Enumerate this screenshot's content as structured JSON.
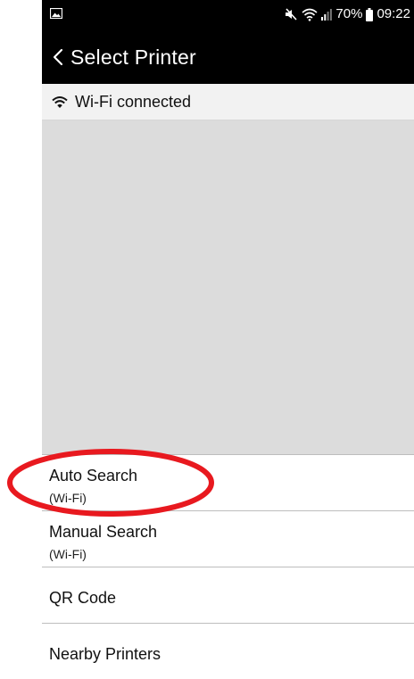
{
  "status_bar": {
    "battery": "70%",
    "time": "09:22"
  },
  "app_bar": {
    "title": "Select Printer"
  },
  "connection": {
    "label": "Wi-Fi connected"
  },
  "menu": {
    "items": [
      {
        "label": "Auto Search",
        "sub": "(Wi-Fi)"
      },
      {
        "label": "Manual Search",
        "sub": "(Wi-Fi)"
      },
      {
        "label": "QR Code"
      },
      {
        "label": "Nearby Printers"
      }
    ]
  },
  "annotation": {
    "highlight_color": "#e8191f"
  },
  "colors": {
    "bar_bg": "#000000",
    "list_area_bg": "#dcdcdc",
    "divider": "#bdbdbd"
  }
}
